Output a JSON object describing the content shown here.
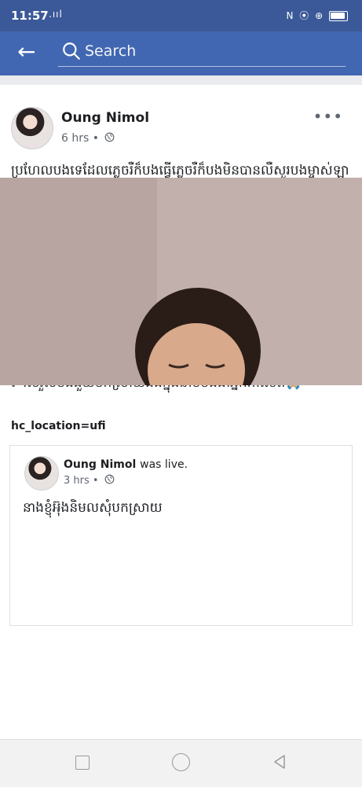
{
  "status_bar": {
    "time": "11:57",
    "left_icons": ".ııl ",
    "right_icons": "N ⦿ ⊕"
  },
  "search": {
    "placeholder": "Search"
  },
  "post": {
    "author": "Oung Nimol",
    "time": "6 hrs",
    "separator": "•",
    "more_label": "•••",
    "body": "ប្រហែលបងទេដែលភ្លេចរឺក៏បងធ្វើភ្លេចរឺក៏បងមិនបានលឺសួរបងម្ចាស់ឡានដែលខ្ញុំប៉ះឡានគាត់ទៅថាតើខ្ញុំមានសុំទោសដែរទេខ្ញុំមិនមែនខួរក្បាលអន់ដល់ម្លឹងទេតែខ្ញុំសុំសួរបងមួយថាខ្ញុំបាននិយាយថាមិនសងរបងផ្ទះបងទេ?ខ្ញុំមានរត់ទៅណាទេ?ហើយផ្ទះខ្ញុំពួកបងក៏ស្គាល់ដែរឡានខ្ញុំក៏នៅនឹងកន្លែងដែរខ្ញុំគិតថាបងប្រុសដូចជាចង់អោយរឿងនេះវាកាន់តែធំហើយបងជួយបកស្រាយរឿងបងយកលេខផ្ទះខ្ញុំទៅផុសជាសាធារណះផងមុននឹងខ្ញុំជៀលបងតើបងជាអ្នកកាសែតមានវិជ្ជាជីវះមែនរឺមិនមែនបានជាយកលេខផ្ទះរបស់ខ្ញុំទៅផុសលើអាខោនfaccbookបងហើយខ្ញុំជាអ្នកបង្ករខ្ញុំក៏ព្រមទទួលហើយម៉េចបានចេញដល់ឈ្មោះបងប្រុសខ្ញុំដែលចេញមុខទៅសំរួលបងជួយបកស្រាយផងក្នុងនាមបងជាអ្នកកាសែត",
    "emoji": "🙏🏼",
    "location": "hc_location=ufi"
  },
  "shared": {
    "author": "Oung Nimol",
    "action": "was live.",
    "time": "3 hrs",
    "separator": "•",
    "text": "នាងខ្ញុំអ៊ុងនិមលសុំបកស្រាយ"
  },
  "colors": {
    "status_bar": "#3b5998",
    "header": "#4267b2",
    "meta_text": "#606770"
  },
  "icons": {
    "back": "←",
    "search": "search-icon",
    "globe": "globe-icon",
    "more": "more-icon"
  }
}
